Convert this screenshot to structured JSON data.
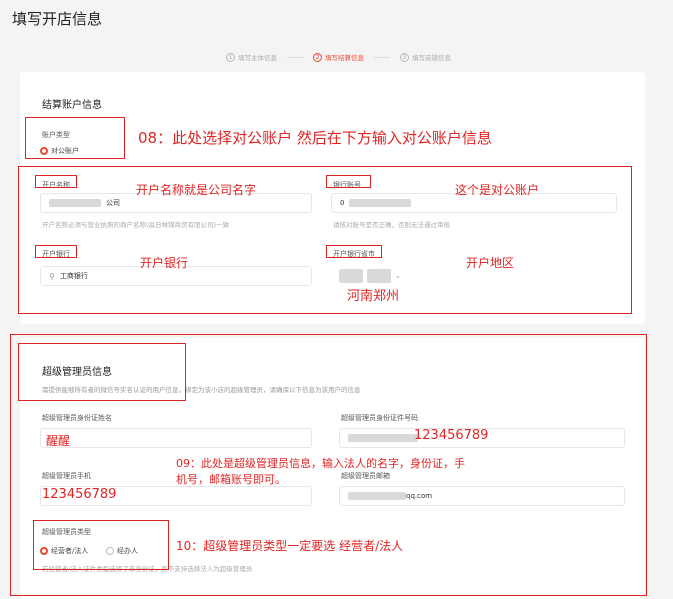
{
  "page_title": "填写开店信息",
  "steps": [
    {
      "num": "1",
      "label": "填写主体信息"
    },
    {
      "num": "2",
      "label": "填写结算信息"
    },
    {
      "num": "3",
      "label": "填写店铺信息"
    }
  ],
  "settlement": {
    "title": "结算账户信息",
    "account_type_label": "账户类型",
    "account_type_value": "对公账户",
    "account_name_label": "开户名称",
    "account_name_value": "公司",
    "account_name_hint": "开户名称必须与营业执照的商户名称(昌日林锦商贸有限公司)一致",
    "bank_account_label": "银行账号",
    "bank_account_value": "0",
    "bank_account_hint": "请核对账号是否正确，否则无法通过审核",
    "bank_label": "开户银行",
    "bank_value": "工商银行",
    "bank_region_label": "开户银行省市"
  },
  "admin": {
    "title": "超级管理员信息",
    "desc": "需提供能够所有者的微信号实名认证的用户信息，绑定为该小店的超级管理员，请确保以下信息为该用户的信息",
    "name_label": "超级管理员身份证姓名",
    "id_label": "超级管理员身份证件号码",
    "phone_label": "超级管理员手机",
    "email_label": "超级管理员邮箱",
    "email_value": "qq.com",
    "type_label": "超级管理员类型",
    "type_options": [
      "经营者/法人",
      "经办人"
    ],
    "type_hint": "若经营者/法人证件类型选择了非身份证，则不支持选择法人为超级管理员"
  },
  "annotations": {
    "a08": "08：此处选择对公账户  然后在下方输入对公账户信息",
    "account_name": "开户名称就是公司名字",
    "bank_account": "这个是对公账户",
    "bank": "开户银行",
    "region": "开户地区",
    "region_value": "河南郑州",
    "name_value": "醒醒",
    "id_value": "123456789",
    "a09_line1": "09：此处是超级管理员信息，输入法人的名字，身份证，手",
    "a09_line2": "机号，邮箱账号即可。",
    "phone_value": "123456789",
    "a10": "10：超级管理员类型一定要选 经营者/法人"
  }
}
